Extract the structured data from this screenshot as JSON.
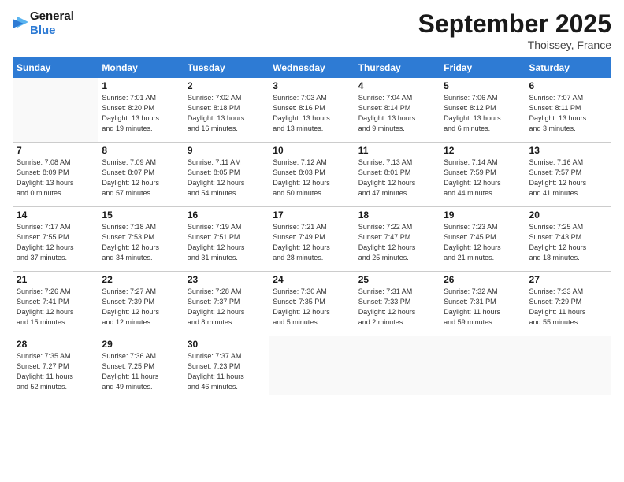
{
  "header": {
    "logo_line1": "General",
    "logo_line2": "Blue",
    "month": "September 2025",
    "location": "Thoissey, France"
  },
  "weekdays": [
    "Sunday",
    "Monday",
    "Tuesday",
    "Wednesday",
    "Thursday",
    "Friday",
    "Saturday"
  ],
  "weeks": [
    [
      {
        "day": "",
        "info": ""
      },
      {
        "day": "1",
        "info": "Sunrise: 7:01 AM\nSunset: 8:20 PM\nDaylight: 13 hours\nand 19 minutes."
      },
      {
        "day": "2",
        "info": "Sunrise: 7:02 AM\nSunset: 8:18 PM\nDaylight: 13 hours\nand 16 minutes."
      },
      {
        "day": "3",
        "info": "Sunrise: 7:03 AM\nSunset: 8:16 PM\nDaylight: 13 hours\nand 13 minutes."
      },
      {
        "day": "4",
        "info": "Sunrise: 7:04 AM\nSunset: 8:14 PM\nDaylight: 13 hours\nand 9 minutes."
      },
      {
        "day": "5",
        "info": "Sunrise: 7:06 AM\nSunset: 8:12 PM\nDaylight: 13 hours\nand 6 minutes."
      },
      {
        "day": "6",
        "info": "Sunrise: 7:07 AM\nSunset: 8:11 PM\nDaylight: 13 hours\nand 3 minutes."
      }
    ],
    [
      {
        "day": "7",
        "info": "Sunrise: 7:08 AM\nSunset: 8:09 PM\nDaylight: 13 hours\nand 0 minutes."
      },
      {
        "day": "8",
        "info": "Sunrise: 7:09 AM\nSunset: 8:07 PM\nDaylight: 12 hours\nand 57 minutes."
      },
      {
        "day": "9",
        "info": "Sunrise: 7:11 AM\nSunset: 8:05 PM\nDaylight: 12 hours\nand 54 minutes."
      },
      {
        "day": "10",
        "info": "Sunrise: 7:12 AM\nSunset: 8:03 PM\nDaylight: 12 hours\nand 50 minutes."
      },
      {
        "day": "11",
        "info": "Sunrise: 7:13 AM\nSunset: 8:01 PM\nDaylight: 12 hours\nand 47 minutes."
      },
      {
        "day": "12",
        "info": "Sunrise: 7:14 AM\nSunset: 7:59 PM\nDaylight: 12 hours\nand 44 minutes."
      },
      {
        "day": "13",
        "info": "Sunrise: 7:16 AM\nSunset: 7:57 PM\nDaylight: 12 hours\nand 41 minutes."
      }
    ],
    [
      {
        "day": "14",
        "info": "Sunrise: 7:17 AM\nSunset: 7:55 PM\nDaylight: 12 hours\nand 37 minutes."
      },
      {
        "day": "15",
        "info": "Sunrise: 7:18 AM\nSunset: 7:53 PM\nDaylight: 12 hours\nand 34 minutes."
      },
      {
        "day": "16",
        "info": "Sunrise: 7:19 AM\nSunset: 7:51 PM\nDaylight: 12 hours\nand 31 minutes."
      },
      {
        "day": "17",
        "info": "Sunrise: 7:21 AM\nSunset: 7:49 PM\nDaylight: 12 hours\nand 28 minutes."
      },
      {
        "day": "18",
        "info": "Sunrise: 7:22 AM\nSunset: 7:47 PM\nDaylight: 12 hours\nand 25 minutes."
      },
      {
        "day": "19",
        "info": "Sunrise: 7:23 AM\nSunset: 7:45 PM\nDaylight: 12 hours\nand 21 minutes."
      },
      {
        "day": "20",
        "info": "Sunrise: 7:25 AM\nSunset: 7:43 PM\nDaylight: 12 hours\nand 18 minutes."
      }
    ],
    [
      {
        "day": "21",
        "info": "Sunrise: 7:26 AM\nSunset: 7:41 PM\nDaylight: 12 hours\nand 15 minutes."
      },
      {
        "day": "22",
        "info": "Sunrise: 7:27 AM\nSunset: 7:39 PM\nDaylight: 12 hours\nand 12 minutes."
      },
      {
        "day": "23",
        "info": "Sunrise: 7:28 AM\nSunset: 7:37 PM\nDaylight: 12 hours\nand 8 minutes."
      },
      {
        "day": "24",
        "info": "Sunrise: 7:30 AM\nSunset: 7:35 PM\nDaylight: 12 hours\nand 5 minutes."
      },
      {
        "day": "25",
        "info": "Sunrise: 7:31 AM\nSunset: 7:33 PM\nDaylight: 12 hours\nand 2 minutes."
      },
      {
        "day": "26",
        "info": "Sunrise: 7:32 AM\nSunset: 7:31 PM\nDaylight: 11 hours\nand 59 minutes."
      },
      {
        "day": "27",
        "info": "Sunrise: 7:33 AM\nSunset: 7:29 PM\nDaylight: 11 hours\nand 55 minutes."
      }
    ],
    [
      {
        "day": "28",
        "info": "Sunrise: 7:35 AM\nSunset: 7:27 PM\nDaylight: 11 hours\nand 52 minutes."
      },
      {
        "day": "29",
        "info": "Sunrise: 7:36 AM\nSunset: 7:25 PM\nDaylight: 11 hours\nand 49 minutes."
      },
      {
        "day": "30",
        "info": "Sunrise: 7:37 AM\nSunset: 7:23 PM\nDaylight: 11 hours\nand 46 minutes."
      },
      {
        "day": "",
        "info": ""
      },
      {
        "day": "",
        "info": ""
      },
      {
        "day": "",
        "info": ""
      },
      {
        "day": "",
        "info": ""
      }
    ]
  ]
}
